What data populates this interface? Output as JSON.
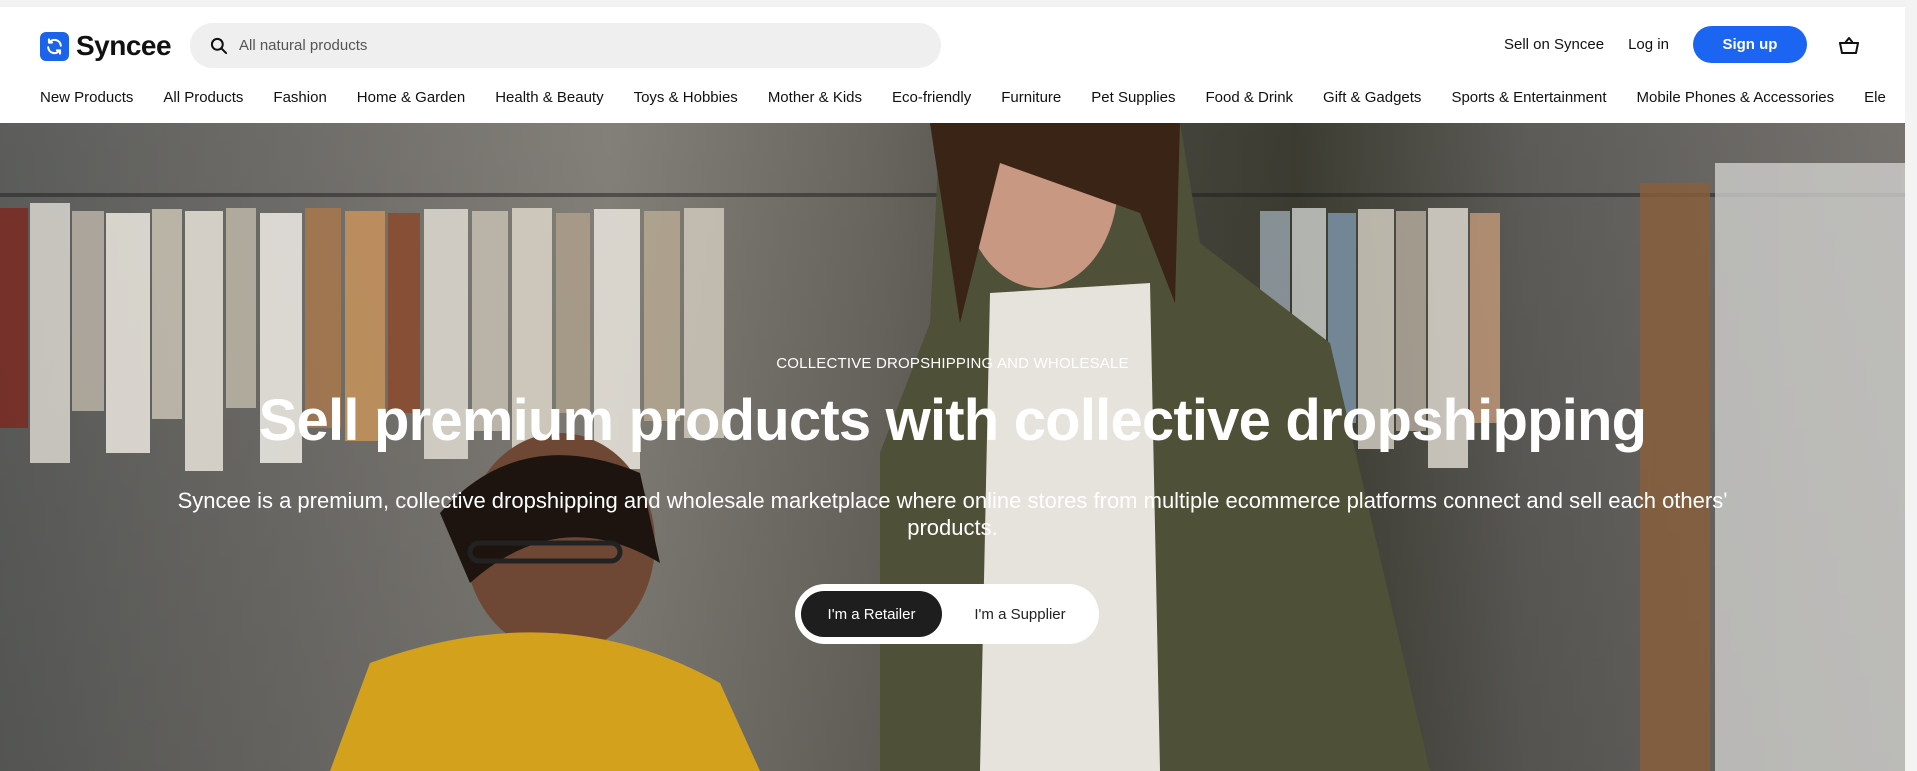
{
  "brand": {
    "name": "Syncee",
    "color": "#1c64f2"
  },
  "search": {
    "placeholder": "All natural products"
  },
  "header_actions": {
    "sell": "Sell on Syncee",
    "login": "Log in",
    "signup": "Sign up"
  },
  "categories": [
    "New Products",
    "All Products",
    "Fashion",
    "Home & Garden",
    "Health & Beauty",
    "Toys & Hobbies",
    "Mother & Kids",
    "Eco-friendly",
    "Furniture",
    "Pet Supplies",
    "Food & Drink",
    "Gift & Gadgets",
    "Sports & Entertainment",
    "Mobile Phones & Accessories",
    "Ele"
  ],
  "hero": {
    "eyebrow": "COLLECTIVE DROPSHIPPING AND WHOLESALE",
    "headline": "Sell premium products with collective dropshipping",
    "subtext": "Syncee is a premium, collective dropshipping and wholesale marketplace where online stores from multiple ecommerce platforms connect and sell each others' products.",
    "toggle": {
      "retailer": "I'm a Retailer",
      "supplier": "I'm a Supplier",
      "selected": "retailer"
    }
  },
  "icons": {
    "logo": "sync-icon",
    "search": "search-icon",
    "cart": "basket-icon"
  }
}
